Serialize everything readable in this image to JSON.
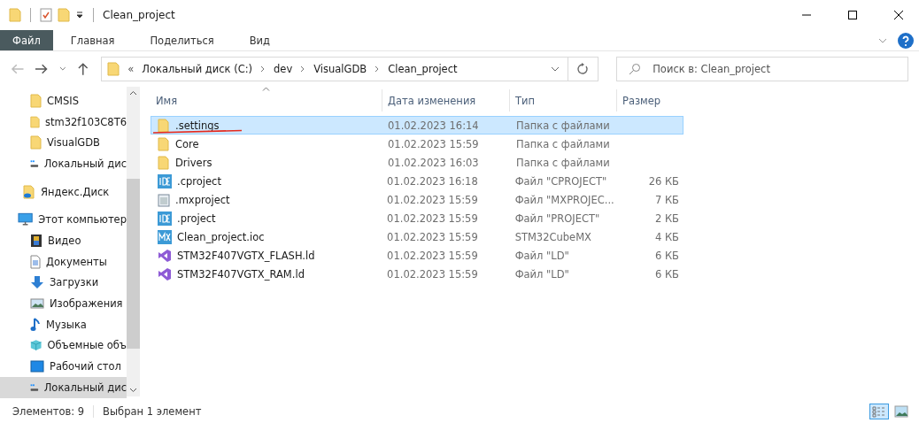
{
  "window": {
    "title": "Clean_project"
  },
  "ribbon_tabs": [
    {
      "label": "Файл",
      "selected": true
    },
    {
      "label": "Главная",
      "selected": false
    },
    {
      "label": "Поделиться",
      "selected": false
    },
    {
      "label": "Вид",
      "selected": false
    }
  ],
  "address": {
    "overflow": "«",
    "crumbs": [
      "Локальный диск (C:)",
      "dev",
      "VisualGDB",
      "Clean_project"
    ]
  },
  "search": {
    "placeholder": "Поиск в: Clean_project"
  },
  "sidebar": {
    "pinned": [
      {
        "label": "CMSIS",
        "kind": "folder",
        "selected": false
      },
      {
        "label": "stm32f103C8T6",
        "kind": "folder",
        "selected": false
      },
      {
        "label": "VisualGDB",
        "kind": "folder",
        "selected": false
      },
      {
        "label": "Локальный дис",
        "kind": "drive",
        "selected": false
      }
    ],
    "cloud": {
      "label": "Яндекс.Диск",
      "kind": "cloud",
      "selected": false
    },
    "computer": {
      "label": "Этот компьютер",
      "kind": "computer",
      "selected": false,
      "children": [
        {
          "label": "Видео",
          "kind": "video",
          "selected": false
        },
        {
          "label": "Документы",
          "kind": "docs",
          "selected": false
        },
        {
          "label": "Загрузки",
          "kind": "downloads",
          "selected": false
        },
        {
          "label": "Изображения",
          "kind": "images",
          "selected": false
        },
        {
          "label": "Музыка",
          "kind": "music",
          "selected": false
        },
        {
          "label": "Объемные объ",
          "kind": "cube",
          "selected": false
        },
        {
          "label": "Рабочий стол",
          "kind": "desktop",
          "selected": false
        },
        {
          "label": "Локальный дис",
          "kind": "drive",
          "selected": true
        }
      ]
    }
  },
  "table": {
    "columns": [
      "Имя",
      "Дата изменения",
      "Тип",
      "Размер"
    ],
    "rows": [
      {
        "name": ".settings",
        "kind": "folder",
        "date": "01.02.2023 16:14",
        "type": "Папка с файлами",
        "size": "",
        "selected": true
      },
      {
        "name": "Core",
        "kind": "folder",
        "date": "01.02.2023 15:59",
        "type": "Папка с файлами",
        "size": "",
        "selected": false
      },
      {
        "name": "Drivers",
        "kind": "folder",
        "date": "01.02.2023 16:03",
        "type": "Папка с файлами",
        "size": "",
        "selected": false
      },
      {
        "name": ".cproject",
        "kind": "ide",
        "date": "01.02.2023 16:18",
        "type": "Файл \"CPROJECT\"",
        "size": "26 КБ",
        "selected": false
      },
      {
        "name": ".mxproject",
        "kind": "text",
        "date": "01.02.2023 15:59",
        "type": "Файл \"MXPROJEC...",
        "size": "7 КБ",
        "selected": false
      },
      {
        "name": ".project",
        "kind": "ide",
        "date": "01.02.2023 15:59",
        "type": "Файл \"PROJECT\"",
        "size": "2 КБ",
        "selected": false
      },
      {
        "name": "Clean_project.ioc",
        "kind": "mx",
        "date": "01.02.2023 15:59",
        "type": "STM32CubeMX",
        "size": "4 КБ",
        "selected": false
      },
      {
        "name": "STM32F407VGTX_FLASH.ld",
        "kind": "vs",
        "date": "01.02.2023 15:59",
        "type": "Файл \"LD\"",
        "size": "6 КБ",
        "selected": false
      },
      {
        "name": "STM32F407VGTX_RAM.ld",
        "kind": "vs",
        "date": "01.02.2023 15:59",
        "type": "Файл \"LD\"",
        "size": "6 КБ",
        "selected": false
      }
    ]
  },
  "status_bar": {
    "count": "Элементов: 9",
    "selection": "Выбран 1 элемент"
  }
}
